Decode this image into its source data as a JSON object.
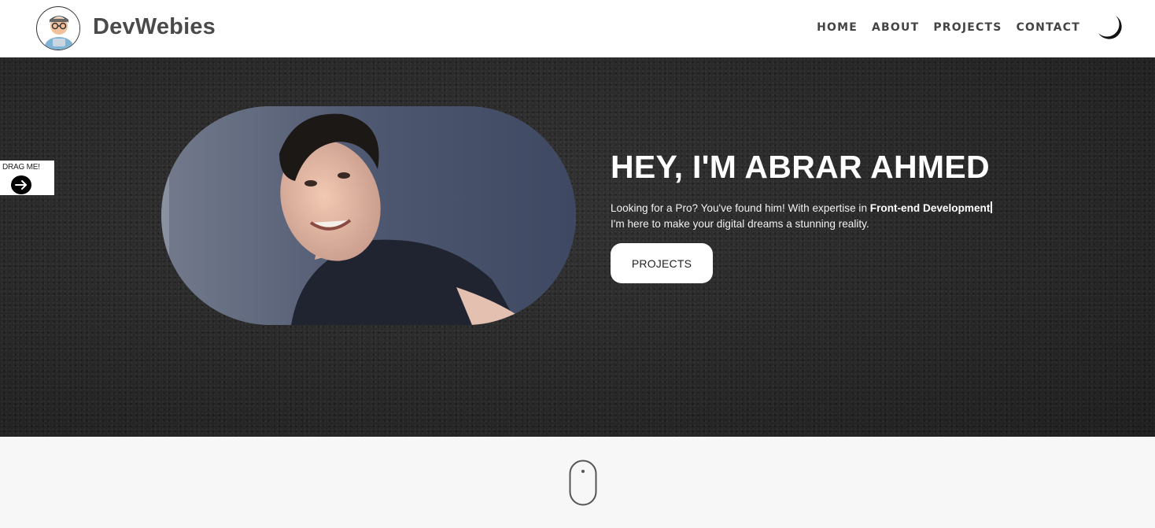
{
  "header": {
    "brand": "DevWebies",
    "nav": [
      {
        "label": "HOME"
      },
      {
        "label": "ABOUT"
      },
      {
        "label": "PROJECTS"
      },
      {
        "label": "CONTACT"
      }
    ],
    "theme_icon": "moon-icon",
    "logo_icon": "developer-avatar-icon"
  },
  "drag_tab": {
    "label": "DRAG ME!",
    "icon": "arrow-right-icon"
  },
  "hero": {
    "title": "HEY, I'M ABRAR AHMED",
    "text_prefix": "Looking for a Pro? You've found him! With expertise in ",
    "text_highlight": "Front-end Development",
    "text_suffix": "I'm here to make your digital dreams a stunning reality.",
    "button_label": "PROJECTS",
    "portrait_icon": "portrait-photo"
  },
  "scroll_hint": {
    "icon": "mouse-scroll-icon"
  },
  "colors": {
    "hero_bg": "#272727",
    "header_bg": "#ffffff",
    "page_bg": "#f7f7f7",
    "brand_text": "#4a4a4a"
  }
}
